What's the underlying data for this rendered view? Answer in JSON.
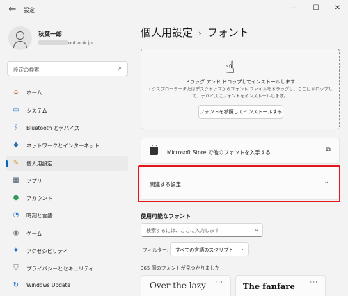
{
  "window": {
    "title": "設定",
    "back": "←",
    "minimize": "—",
    "maximize": "☐",
    "close": "✕"
  },
  "user": {
    "name": "秋葉一郎",
    "email_suffix": "outlook.jp"
  },
  "search": {
    "placeholder": "設定の検索",
    "icon": "⌕"
  },
  "sidebar": {
    "items": [
      {
        "label": "ホーム",
        "icon": "⌂",
        "icon_name": "home-icon",
        "color": "#c0581f"
      },
      {
        "label": "システム",
        "icon": "▭",
        "icon_name": "system-icon",
        "color": "#2a7fd4"
      },
      {
        "label": "Bluetooth とデバイス",
        "icon": "ᛒ",
        "icon_name": "bluetooth-icon",
        "color": "#1f6fc9"
      },
      {
        "label": "ネットワークとインターネット",
        "icon": "◆",
        "icon_name": "wifi-icon",
        "color": "#2d6ea8"
      },
      {
        "label": "個人用設定",
        "icon": "✎",
        "icon_name": "personalization-icon",
        "color": "#d68a1e"
      },
      {
        "label": "アプリ",
        "icon": "▦",
        "icon_name": "apps-icon",
        "color": "#4a5a70"
      },
      {
        "label": "アカウント",
        "icon": "●",
        "icon_name": "account-icon",
        "color": "#2f9a5a"
      },
      {
        "label": "時刻と言語",
        "icon": "◔",
        "icon_name": "time-language-icon",
        "color": "#2a7fd4"
      },
      {
        "label": "ゲーム",
        "icon": "◉",
        "icon_name": "gaming-icon",
        "color": "#7a7a7a"
      },
      {
        "label": "アクセシビリティ",
        "icon": "✦",
        "icon_name": "accessibility-icon",
        "color": "#1f6fc9"
      },
      {
        "label": "プライバシーとセキュリティ",
        "icon": "⛉",
        "icon_name": "privacy-shield-icon",
        "color": "#6a6a6a"
      },
      {
        "label": "Windows Update",
        "icon": "↻",
        "icon_name": "windows-update-icon",
        "color": "#1f6fc9"
      }
    ]
  },
  "breadcrumb": {
    "parent": "個人用設定",
    "separator": "›",
    "current": "フォント"
  },
  "dropzone": {
    "title": "ドラッグ アンド ドロップしてインストールします",
    "desc": "エクスプローラーまたはデスクトップからフォント ファイルをドラッグし、ここにドロップして、デバイスにフォントをインストールします。",
    "button": "フォントを参照してインストールする",
    "icon": "☝"
  },
  "store": {
    "label": "Microsoft Store で他のフォントを入手する",
    "external_icon": "⧉"
  },
  "related": {
    "label": "関連する設定",
    "chevron": "⌄"
  },
  "available": {
    "title": "使用可能なフォント",
    "search_placeholder": "検索するには、ここに入力します",
    "search_icon": "⌕",
    "filter_label": "フィルター:",
    "filter_value": "すべての言語のスクリプト",
    "filter_arrow": "⌄",
    "count": "365 個のフォントが見つかりました"
  },
  "previews": [
    {
      "sample": "Over the lazy",
      "more": "···"
    },
    {
      "sample": "The fanfare",
      "more": "···"
    }
  ]
}
